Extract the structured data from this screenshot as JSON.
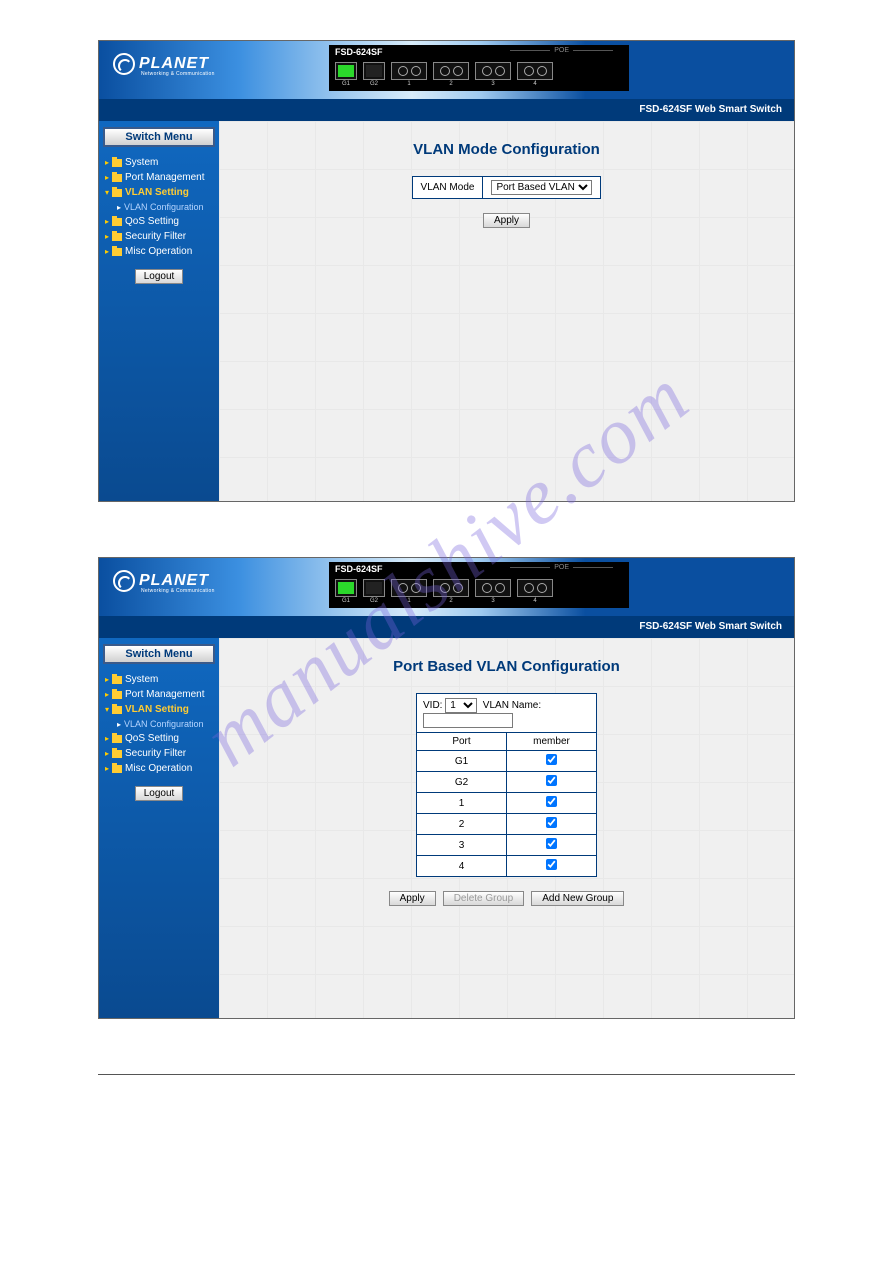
{
  "watermark": "manualshive.com",
  "device": {
    "model": "FSD-624SF",
    "poe_label": "POE",
    "product_line": "FSD-624SF Web Smart Switch",
    "brand": "PLANET",
    "brand_sub": "Networking & Communication",
    "port_labels": [
      "G1",
      "G2",
      "1",
      "2",
      "3",
      "4"
    ]
  },
  "sidebar": {
    "title": "Switch Menu",
    "items": [
      {
        "label": "System"
      },
      {
        "label": "Port Management"
      },
      {
        "label": "VLAN Setting",
        "active": true
      },
      {
        "label": "VLAN Configuration",
        "sub": true
      },
      {
        "label": "QoS Setting"
      },
      {
        "label": "Security Filter"
      },
      {
        "label": "Misc Operation"
      }
    ],
    "logout": "Logout"
  },
  "shot1": {
    "title": "VLAN Mode Configuration",
    "field_label": "VLAN Mode",
    "field_value": "Port Based VLAN",
    "apply": "Apply"
  },
  "shot2": {
    "title": "Port Based VLAN Configuration",
    "vid_label": "VID:",
    "vid_value": "1",
    "vlan_name_label": "VLAN Name:",
    "vlan_name_value": "",
    "col_port": "Port",
    "col_member": "member",
    "rows": [
      {
        "port": "G1",
        "member": true
      },
      {
        "port": "G2",
        "member": true
      },
      {
        "port": "1",
        "member": true
      },
      {
        "port": "2",
        "member": true
      },
      {
        "port": "3",
        "member": true
      },
      {
        "port": "4",
        "member": true
      }
    ],
    "btn_apply": "Apply",
    "btn_delete": "Delete Group",
    "btn_add": "Add New Group"
  }
}
